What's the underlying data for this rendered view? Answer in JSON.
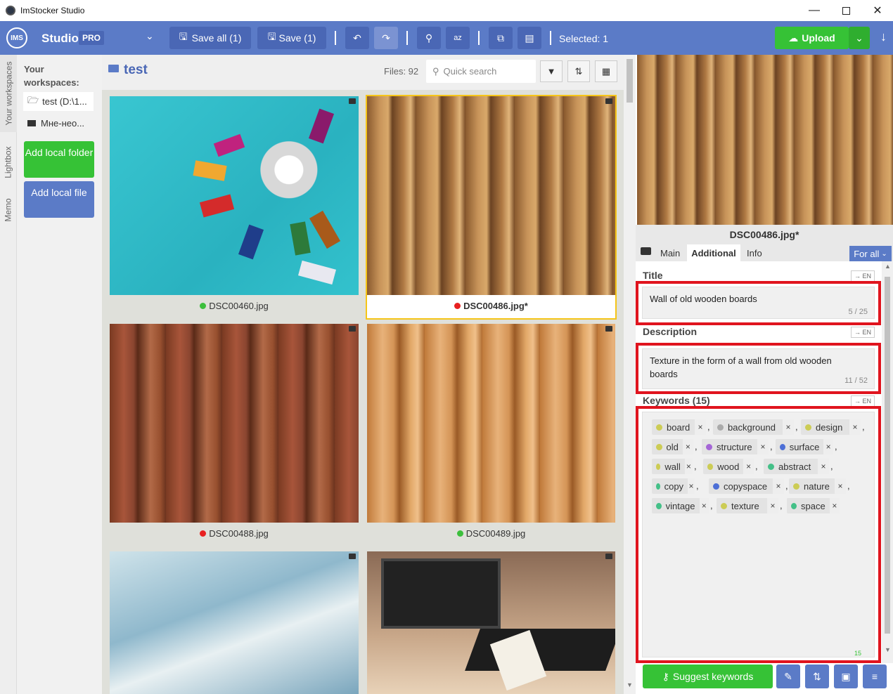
{
  "window": {
    "title": "ImStocker Studio",
    "min": "—",
    "max": "☐",
    "close": "✕"
  },
  "toolbar": {
    "logo": "IMS",
    "studio": "Studio",
    "pro": "PRO",
    "save_all": "Save all (1)",
    "save": "Save (1)",
    "selected": "Selected: 1",
    "upload": "Upload"
  },
  "sidebar": {
    "tabs": [
      "Your workspaces",
      "Lightbox",
      "Memo"
    ],
    "heading": "Your workspaces:",
    "items": [
      "test (D:\\1...",
      "Мне-нео..."
    ],
    "add_folder": "Add local folder",
    "add_file": "Add local file"
  },
  "gallery": {
    "folder": "test",
    "files": "Files: 92",
    "search_placeholder": "Quick search",
    "items": [
      {
        "name": "DSC00460.jpg",
        "status": "#3cbf3c"
      },
      {
        "name": "DSC00486.jpg*",
        "status": "#e82020"
      },
      {
        "name": "DSC00488.jpg",
        "status": "#e82020"
      },
      {
        "name": "DSC00489.jpg",
        "status": "#3cbf3c"
      }
    ]
  },
  "panel": {
    "filename": "DSC00486.jpg*",
    "tabs": [
      "Main",
      "Additional",
      "Info"
    ],
    "for_all": "For all",
    "title_label": "Title",
    "title_value": "Wall of old wooden boards",
    "title_count": "5 / 25",
    "desc_label": "Description",
    "desc_value": "Texture in the form of a wall from old wooden boards",
    "desc_count": "11 / 52",
    "kw_label": "Keywords (15)",
    "en": "→ EN",
    "kw_counter": "15",
    "keywords": [
      {
        "text": "board",
        "color": "#cccc55"
      },
      {
        "text": "background",
        "color": "#aaaaaa"
      },
      {
        "text": "design",
        "color": "#cccc55"
      },
      {
        "text": "old",
        "color": "#cccc55"
      },
      {
        "text": "structure",
        "color": "#a566d6"
      },
      {
        "text": "surface",
        "color": "#4d6fd6"
      },
      {
        "text": "wall",
        "color": "#cccc55"
      },
      {
        "text": "wood",
        "color": "#cccc55"
      },
      {
        "text": "abstract",
        "color": "#44c088"
      },
      {
        "text": "copy",
        "color": "#44c088"
      },
      {
        "text": "copyspace",
        "color": "#4d6fd6"
      },
      {
        "text": "nature",
        "color": "#cccc55"
      },
      {
        "text": "vintage",
        "color": "#44c088"
      },
      {
        "text": "texture",
        "color": "#cccc55"
      },
      {
        "text": "space",
        "color": "#44c088"
      }
    ],
    "suggest": "Suggest keywords"
  }
}
